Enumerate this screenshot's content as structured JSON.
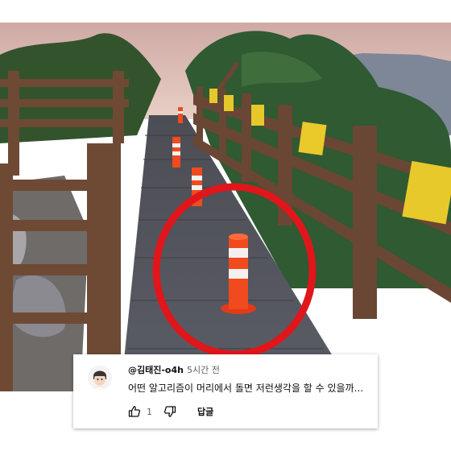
{
  "comment": {
    "author": "@김태진-o4h",
    "time": "5시간 전",
    "text": "어떤 알고리즘이 머리에서 돌면 저런생각을 할 수 있을까...",
    "like_count": "1",
    "reply_label": "답글"
  },
  "icons": {
    "like": "thumbs-up-icon",
    "dislike": "thumbs-down-icon"
  },
  "colors": {
    "highlight_circle": "#e0161b",
    "bollard": "#f04a1e"
  }
}
